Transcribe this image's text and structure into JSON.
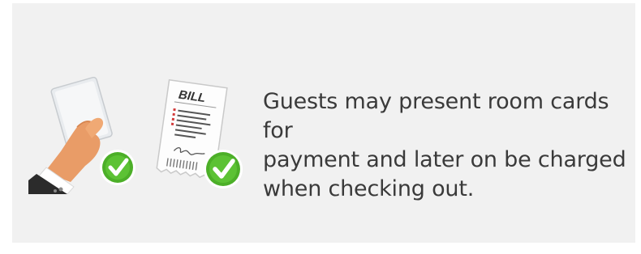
{
  "feature": {
    "illustration": {
      "card_payment_icon": "hand-holding-card-icon",
      "bill_icon": "bill-receipt-icon",
      "check_icon": "check-circle-icon",
      "bill_label": "BILL",
      "accent_green": "#4caf28",
      "skin_color": "#e99c67",
      "suit_color": "#2b2b2b"
    },
    "caption": "Guests may present room cards for\npayment and later on be charged\nwhen checking out."
  }
}
